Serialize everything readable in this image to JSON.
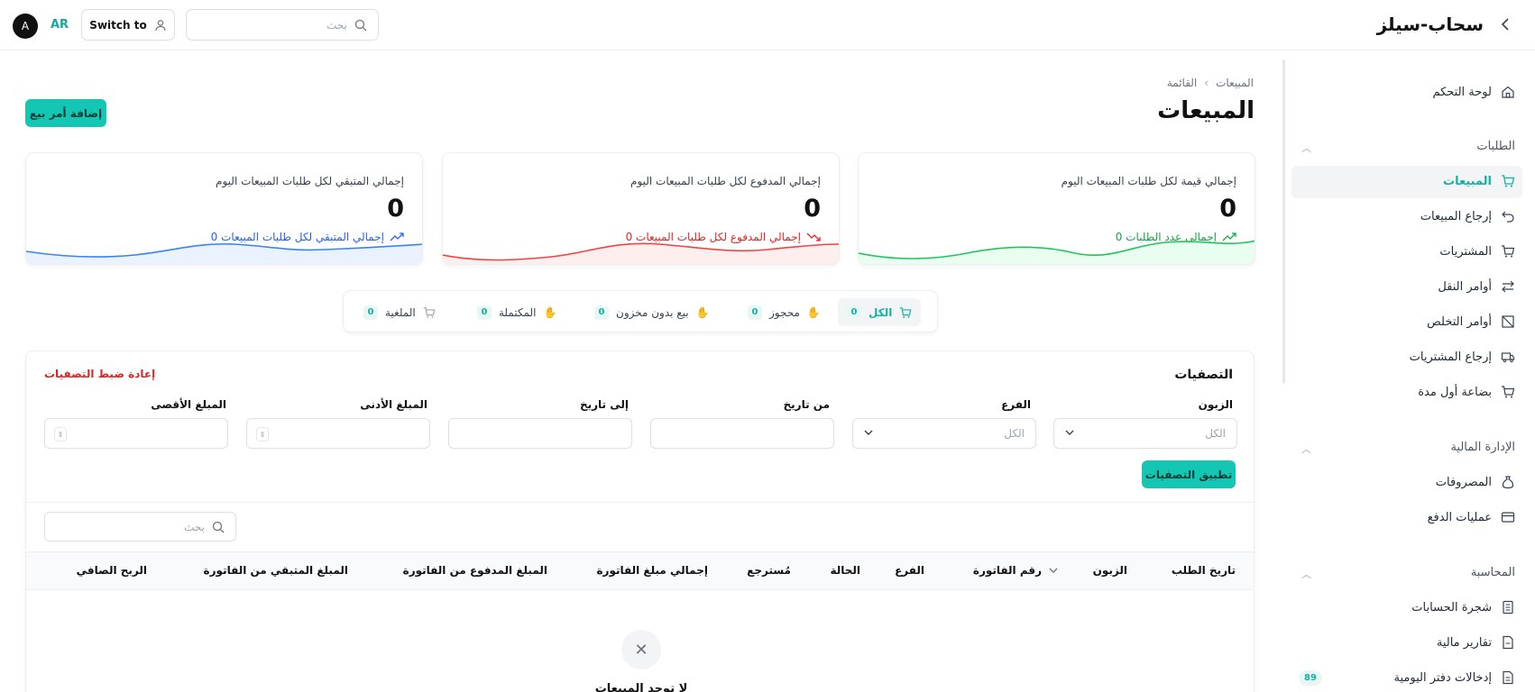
{
  "header": {
    "avatar_initial": "A",
    "language": "AR",
    "switch_label": "Switch to",
    "search_placeholder": "بحث",
    "brand": "سحاب-سيلز"
  },
  "sidebar": {
    "dashboard": "لوحة التحكم",
    "sections": [
      {
        "title": "الطلبات",
        "items": [
          "المبيعات",
          "إرجاع المبيعات",
          "المشتريات",
          "أوامر النقل",
          "أوامر التخلص",
          "إرجاع المشتريات",
          "بضاعة أول مدة"
        ]
      },
      {
        "title": "الإدارة المالية",
        "items": [
          "المصروفات",
          "عمليات الدفع"
        ]
      },
      {
        "title": "المحاسبة",
        "items": [
          "شجرة الحسابات",
          "تقارير مالية",
          "إدخالات دفتر اليومية"
        ]
      }
    ],
    "journal_badge": "89"
  },
  "page": {
    "breadcrumb_parent": "المبيعات",
    "breadcrumb_current": "القائمة",
    "title": "المبيعات",
    "add_button": "إضافة أمر بيع"
  },
  "cards": [
    {
      "label": "إجمالي قيمة لكل طلبات المبيعات اليوم",
      "value": "0",
      "sub": "إجمالي عدد الطلبات 0",
      "color": "#16a34a"
    },
    {
      "label": "إجمالي المدفوع لكل طلبات المبيعات اليوم",
      "value": "0",
      "sub": "إجمالي المدفوع لكل طلبات المبيعات 0",
      "color": "#dc2626"
    },
    {
      "label": "إجمالي المتبقي لكل طلبات المبيعات اليوم",
      "value": "0",
      "sub": "إجمالي المتبقي لكل طلبات المبيعات 0",
      "color": "#2563eb"
    }
  ],
  "tabs": [
    {
      "label": "الكل",
      "count": "0"
    },
    {
      "label": "محجوز",
      "count": "0"
    },
    {
      "label": "بيع بدون مخزون",
      "count": "0"
    },
    {
      "label": "المكتملة",
      "count": "0"
    },
    {
      "label": "الملغية",
      "count": "0"
    }
  ],
  "filters": {
    "title": "التصفيات",
    "reset": "إعادة ضبط التصفيات",
    "customer_label": "الزبون",
    "customer_value": "الكل",
    "branch_label": "الفرع",
    "branch_value": "الكل",
    "from_date_label": "من تاريخ",
    "to_date_label": "إلى تاريخ",
    "min_amount_label": "المبلغ الأدنى",
    "max_amount_label": "المبلغ الأقصى",
    "apply": "تطبيق التصفيات"
  },
  "table": {
    "search_placeholder": "بحث",
    "columns": [
      "تاريخ الطلب",
      "الزبون",
      "رقم الفاتورة",
      "الفرع",
      "الحالة",
      "مُسترجع",
      "إجمالي مبلغ الفاتورة",
      "المبلغ المدفوع من الفاتورة",
      "المبلغ المتبقي من الفاتورة",
      "الربح الصافي"
    ],
    "empty_text": "لا توجد المبيعات"
  },
  "colors": {
    "accent": "#14c7b5",
    "danger": "#dc2626"
  }
}
